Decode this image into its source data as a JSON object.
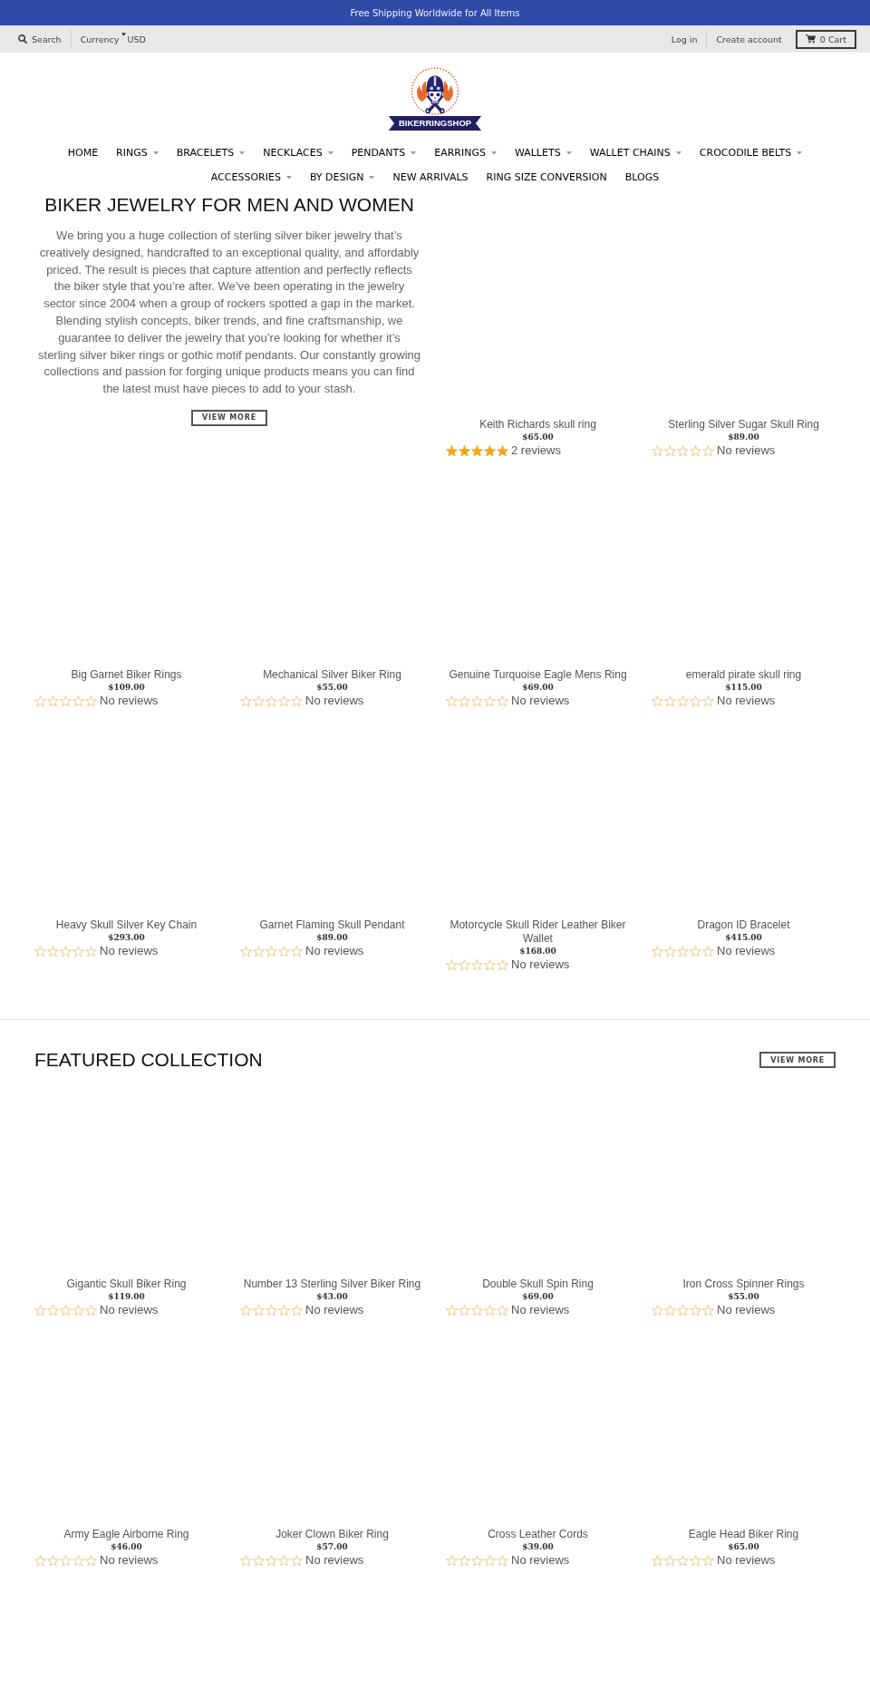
{
  "announcement": {
    "text": "Free Shipping Worldwide for All Items"
  },
  "utility_bar": {
    "search": {
      "label": "Search"
    },
    "currency": {
      "label": "Currency",
      "value": "USD"
    },
    "login": {
      "label": "Log in"
    },
    "create_account": {
      "label": "Create account"
    },
    "cart": {
      "label": "0 Cart"
    }
  },
  "logo": {
    "text": "BIKERRINGSHOP"
  },
  "nav": {
    "rows": [
      {
        "items": [
          {
            "label": "HOME",
            "dropdown": false
          },
          {
            "label": "RINGS",
            "dropdown": true
          },
          {
            "label": "BRACELETS",
            "dropdown": true
          },
          {
            "label": "NECKLACES",
            "dropdown": true
          },
          {
            "label": "PENDANTS",
            "dropdown": true
          },
          {
            "label": "EARRINGS",
            "dropdown": true
          },
          {
            "label": "WALLETS",
            "dropdown": true
          },
          {
            "label": "WALLET CHAINS",
            "dropdown": true
          },
          {
            "label": "CROCODILE BELTS",
            "dropdown": true
          }
        ]
      },
      {
        "items": [
          {
            "label": "ACCESSORIES",
            "dropdown": true
          },
          {
            "label": "BY DESIGN",
            "dropdown": true
          },
          {
            "label": "NEW ARRIVALS",
            "dropdown": false
          },
          {
            "label": "RING SIZE CONVERSION",
            "dropdown": false
          },
          {
            "label": "BLOGS",
            "dropdown": false
          }
        ]
      }
    ]
  },
  "intro": {
    "title": "BIKER JEWELRY FOR MEN AND WOMEN",
    "text": "We bring you a huge collection of sterling silver biker jewelry that’s creatively designed, handcrafted to an exceptional quality, and affordably priced. The result is pieces that capture attention and perfectly reflects the biker style that you’re after. We’ve been operating in the jewelry sector since 2004 when a group of rockers spotted a gap in the market. Blending stylish concepts, biker trends, and fine craftsmanship, we guarantee to deliver the jewelry that you’re looking for whether it’s sterling silver biker rings or gothic motif pendants. Our constantly growing collections and passion for forging unique products means you can find the latest must have pieces to add to your stash.",
    "button": "VIEW MORE"
  },
  "products": [
    {
      "name": "Keith Richards skull ring",
      "price": "$65.00",
      "stars": 5,
      "reviews": "2 reviews"
    },
    {
      "name": "Sterling Silver Sugar Skull Ring",
      "price": "$89.00",
      "stars": 0,
      "reviews": "No reviews"
    },
    {
      "name": "Big Garnet Biker Rings",
      "price": "$109.00",
      "stars": 0,
      "reviews": "No reviews"
    },
    {
      "name": "Mechanical Silver Biker Ring",
      "price": "$55.00",
      "stars": 0,
      "reviews": "No reviews"
    },
    {
      "name": "Genuine Turquoise Eagle Mens Ring",
      "price": "$69.00",
      "stars": 0,
      "reviews": "No reviews"
    },
    {
      "name": "emerald pirate skull ring",
      "price": "$115.00",
      "stars": 0,
      "reviews": "No reviews"
    },
    {
      "name": "Heavy Skull Silver Key Chain",
      "price": "$293.00",
      "stars": 0,
      "reviews": "No reviews"
    },
    {
      "name": "Garnet Flaming Skull Pendant",
      "price": "$89.00",
      "stars": 0,
      "reviews": "No reviews"
    },
    {
      "name": "Motorcycle Skull Rider Leather Biker Wallet",
      "price": "$168.00",
      "stars": 0,
      "reviews": "No reviews"
    },
    {
      "name": "Dragon ID Bracelet",
      "price": "$415.00",
      "stars": 0,
      "reviews": "No reviews"
    }
  ],
  "featured": {
    "title": "FEATURED COLLECTION",
    "button": "VIEW MORE",
    "products": [
      {
        "name": "Gigantic Skull Biker Ring",
        "price": "$119.00",
        "stars": 0,
        "reviews": "No reviews"
      },
      {
        "name": "Number 13 Sterling Silver Biker Ring",
        "price": "$43.00",
        "stars": 0,
        "reviews": "No reviews"
      },
      {
        "name": "Double Skull Spin Ring",
        "price": "$69.00",
        "stars": 0,
        "reviews": "No reviews"
      },
      {
        "name": "Iron Cross Spinner Rings",
        "price": "$55.00",
        "stars": 0,
        "reviews": "No reviews"
      },
      {
        "name": "Army Eagle Airborne Ring",
        "price": "$46.00",
        "stars": 0,
        "reviews": "No reviews"
      },
      {
        "name": "Joker Clown Biker Ring",
        "price": "$57.00",
        "stars": 0,
        "reviews": "No reviews"
      },
      {
        "name": "Cross Leather Cords",
        "price": "$39.00",
        "stars": 0,
        "reviews": "No reviews"
      },
      {
        "name": "Eagle Head Biker Ring",
        "price": "$65.00",
        "stars": 0,
        "reviews": "No reviews"
      }
    ]
  }
}
